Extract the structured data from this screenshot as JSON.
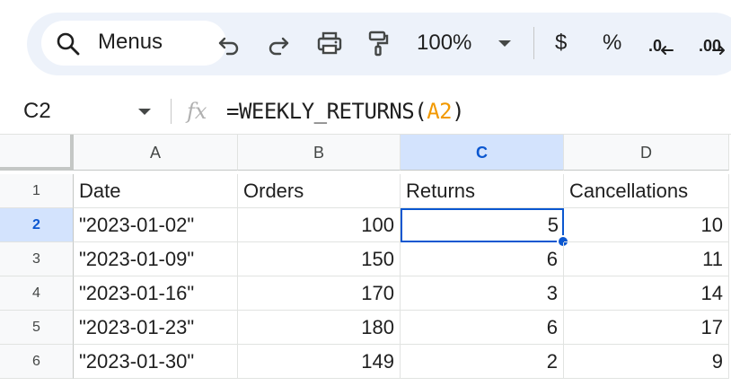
{
  "toolbar": {
    "search_label": "Menus",
    "zoom": "100%",
    "currency_label": "$",
    "percent_label": "%",
    "decrease_decimal_label": ".0",
    "increase_decimal_label": ".00",
    "icons": [
      "search-icon",
      "undo-icon",
      "redo-icon",
      "print-icon",
      "paint-format-icon",
      "currency-icon",
      "percent-icon"
    ]
  },
  "formula_bar": {
    "cell_ref": "C2",
    "fx_label": "fx",
    "formula_prefix": "=WEEKLY_RETURNS(",
    "formula_ref": "A2",
    "formula_suffix": ")"
  },
  "grid": {
    "columns": [
      "A",
      "B",
      "C",
      "D"
    ],
    "selected_column": "C",
    "row_numbers": [
      "1",
      "2",
      "3",
      "4",
      "5",
      "6"
    ],
    "selected_row": "2",
    "rows": [
      [
        "Date",
        "Orders",
        "Returns",
        "Cancellations"
      ],
      [
        "\"2023-01-02\"",
        "100",
        "5",
        "10"
      ],
      [
        "\"2023-01-09\"",
        "150",
        "6",
        "11"
      ],
      [
        "\"2023-01-16\"",
        "170",
        "3",
        "14"
      ],
      [
        "\"2023-01-23\"",
        "180",
        "6",
        "17"
      ],
      [
        "\"2023-01-30\"",
        "149",
        "2",
        "9"
      ]
    ]
  },
  "colors": {
    "accent": "#0b57d0",
    "selection_header": "#d3e3fd",
    "toolbar_background": "#edf2fa",
    "formula_reference": "#f29900"
  }
}
